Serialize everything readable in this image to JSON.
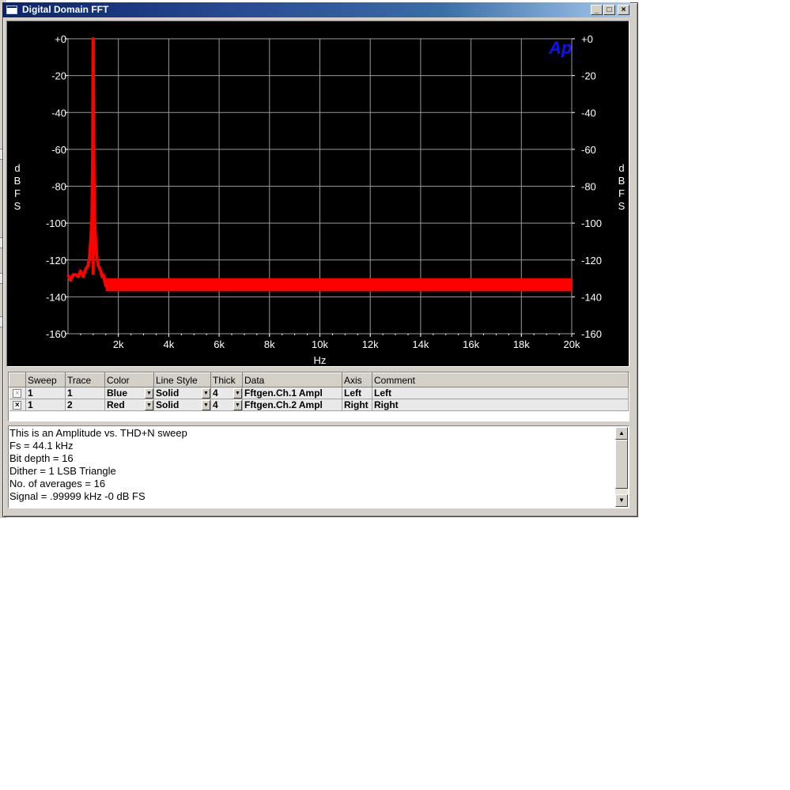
{
  "window": {
    "title": "Digital Domain FFT"
  },
  "title_buttons": {
    "minimize": "_",
    "maximize": "□",
    "close": "×"
  },
  "plot": {
    "logo": "Ap",
    "x_axis_label": "Hz",
    "left_axis_label": [
      "d",
      "B",
      "F",
      "S"
    ],
    "right_axis_label": [
      "d",
      "B",
      "F",
      "S"
    ],
    "trace_color": "#ff0000",
    "background_color": "#000000",
    "grid_color": "#9a9a9a"
  },
  "chart_data": {
    "type": "line",
    "x_tick_labels": [
      "2k",
      "4k",
      "6k",
      "8k",
      "10k",
      "12k",
      "14k",
      "16k",
      "18k",
      "20k"
    ],
    "x_ticks": [
      2000,
      4000,
      6000,
      8000,
      10000,
      12000,
      14000,
      16000,
      18000,
      20000
    ],
    "xlim": [
      0,
      20000
    ],
    "y_tick_labels": [
      "+0",
      "-20",
      "-40",
      "-60",
      "-80",
      "-100",
      "-120",
      "-140",
      "-160"
    ],
    "y_ticks": [
      0,
      -20,
      -40,
      -60,
      -80,
      -100,
      -120,
      -140,
      -160
    ],
    "ylim": [
      -160,
      0
    ],
    "xlabel": "Hz",
    "ylabel": "dBFS",
    "series": [
      {
        "color": "#ff0000",
        "points": [
          [
            0,
            -128
          ],
          [
            100,
            -131
          ],
          [
            200,
            -128
          ],
          [
            300,
            -128
          ],
          [
            400,
            -129
          ],
          [
            500,
            -126
          ],
          [
            600,
            -129
          ],
          [
            700,
            -125
          ],
          [
            800,
            -123
          ],
          [
            850,
            -119
          ],
          [
            900,
            -110
          ],
          [
            950,
            -97
          ],
          [
            980,
            -60
          ],
          [
            1000,
            0
          ],
          [
            1020,
            -60
          ],
          [
            1050,
            -97
          ],
          [
            1100,
            -110
          ],
          [
            1150,
            -119
          ],
          [
            1200,
            -123
          ],
          [
            1300,
            -126
          ],
          [
            1350,
            -129
          ],
          [
            1400,
            -128
          ],
          [
            1500,
            -134
          ],
          [
            1700,
            -134
          ],
          [
            3000,
            -134
          ],
          [
            5000,
            -134
          ],
          [
            8000,
            -134
          ],
          [
            11000,
            -134
          ],
          [
            14000,
            -134
          ],
          [
            17000,
            -134
          ],
          [
            20000,
            -134
          ]
        ],
        "noise_band": [
          -137,
          -130
        ],
        "noise_start_hz": 1500
      }
    ]
  },
  "table": {
    "headers": [
      "",
      "Sweep",
      "Trace",
      "Color",
      "Line Style",
      "Thick",
      "Data",
      "Axis",
      "Comment"
    ],
    "rows": [
      {
        "check": "×",
        "sweep": "1",
        "trace": "1",
        "color": "Blue",
        "line_style": "Solid",
        "thick": "4",
        "data": "Fftgen.Ch.1 Ampl",
        "axis": "Left",
        "comment": "Left"
      },
      {
        "check": "×",
        "sweep": "1",
        "trace": "2",
        "color": "Red",
        "line_style": "Solid",
        "thick": "4",
        "data": "Fftgen.Ch.2 Ampl",
        "axis": "Right",
        "comment": "Right"
      }
    ]
  },
  "notes": [
    "This is an Amplitude vs. THD+N sweep",
    "Fs = 44.1 kHz",
    "Bit depth = 16",
    "Dither = 1 LSB Triangle",
    "No. of averages = 16",
    "Signal = .99999 kHz -0 dB FS"
  ]
}
